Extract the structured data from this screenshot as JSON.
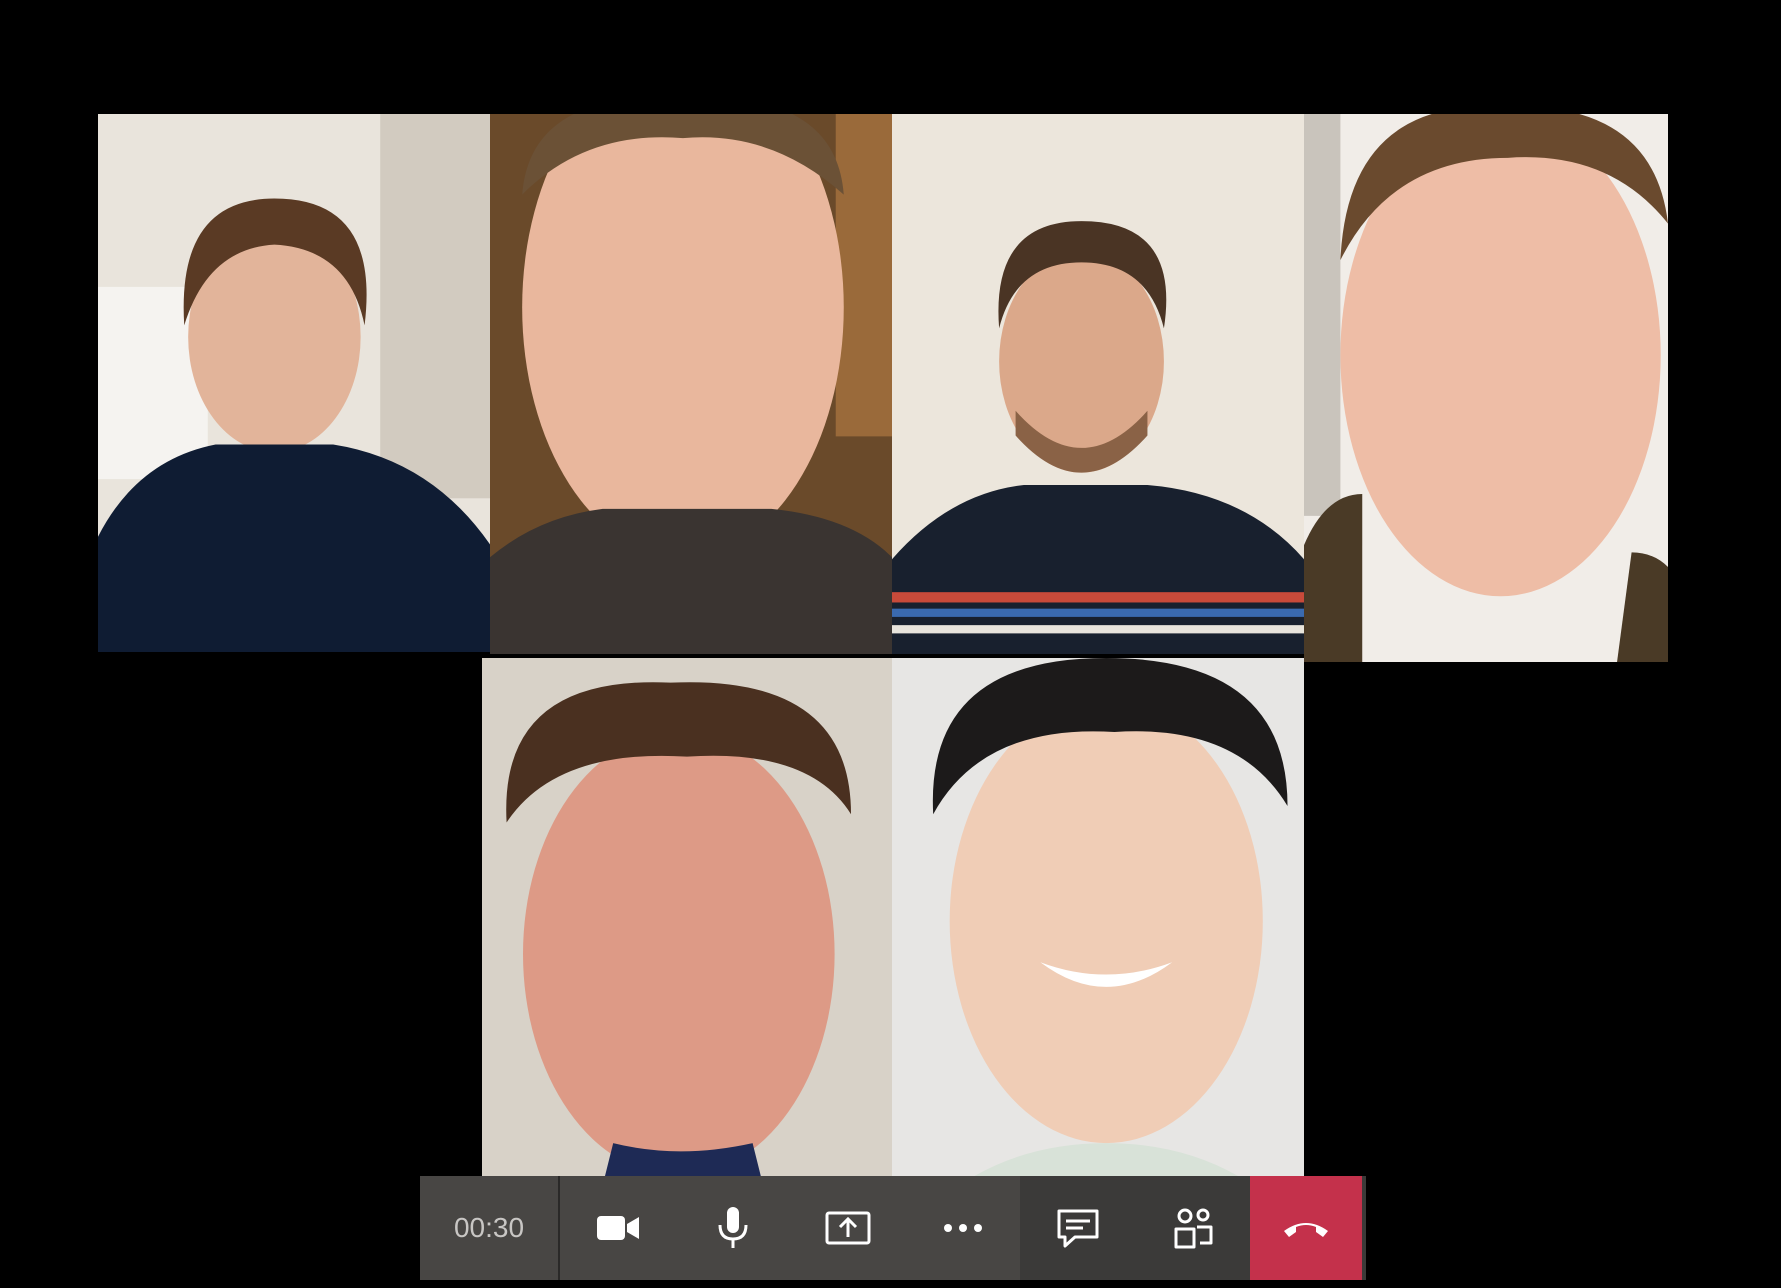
{
  "call": {
    "timer": "00:30"
  },
  "participants": [
    {
      "id": "p1",
      "bg": "#e9e4dc",
      "shirt": "#0f1c33",
      "skin": "#e2b49a",
      "hair": "#5a3a24"
    },
    {
      "id": "p2",
      "bg": "#6a4a2a",
      "shirt": "#3a3431",
      "skin": "#e9b79d",
      "hair": "#6b5136"
    },
    {
      "id": "p3",
      "bg": "#ece6dc",
      "shirt": "#18202e",
      "skin": "#dba88a",
      "hair": "#4a3424"
    },
    {
      "id": "p4",
      "bg": "#f1ede8",
      "shirt": "#4a3a26",
      "skin": "#eebda6",
      "hair": "#6a4a2e"
    },
    {
      "id": "p5",
      "bg": "#d8d2c8",
      "shirt": "#1e2a55",
      "skin": "#dd9a86",
      "hair": "#4a3020"
    },
    {
      "id": "p6",
      "bg": "#e7e6e4",
      "shirt": "#d8e2d8",
      "skin": "#f0cdb6",
      "hair": "#1c1a1a"
    }
  ],
  "controls": [
    {
      "name": "camera-icon"
    },
    {
      "name": "microphone-icon"
    },
    {
      "name": "share-screen-icon"
    },
    {
      "name": "more-options-icon"
    },
    {
      "name": "chat-icon"
    },
    {
      "name": "participants-icon"
    },
    {
      "name": "hang-up-icon"
    }
  ],
  "colors": {
    "bar": "#484644",
    "bar_dark": "#3b3a39",
    "hangup": "#c4314b",
    "icon": "#ffffff",
    "timer_text": "#c8c6c4"
  }
}
